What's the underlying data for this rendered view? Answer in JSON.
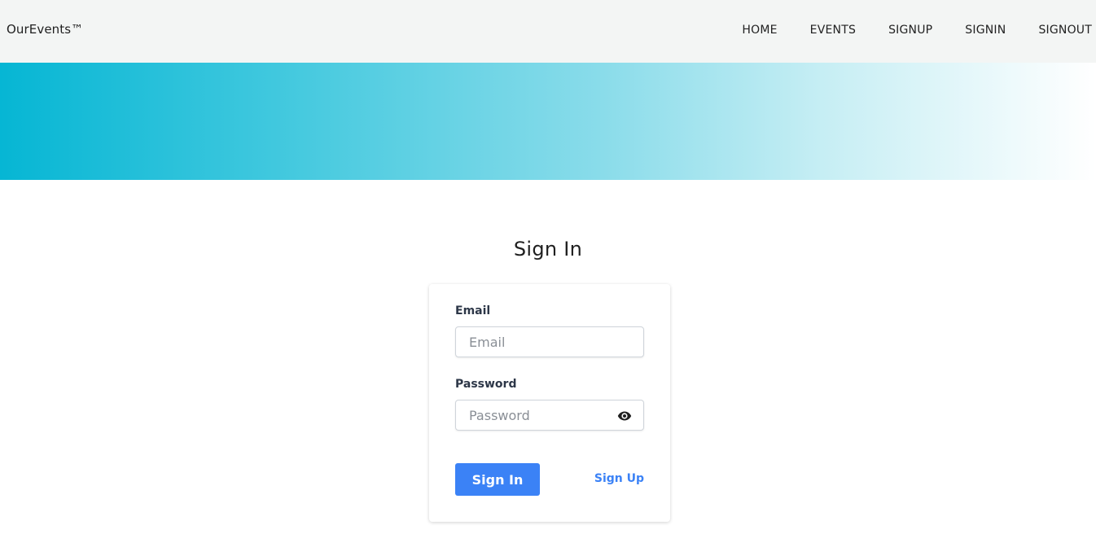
{
  "navbar": {
    "brand": "OurEvents™",
    "links": [
      {
        "label": "HOME"
      },
      {
        "label": "EVENTS"
      },
      {
        "label": "SIGNUP"
      },
      {
        "label": "SIGNIN"
      },
      {
        "label": "SIGNOUT"
      }
    ]
  },
  "page": {
    "title": "Sign In"
  },
  "form": {
    "email_label": "Email",
    "email_placeholder": "Email",
    "email_value": "",
    "password_label": "Password",
    "password_placeholder": "Password",
    "password_value": "",
    "password_toggle_icon": "eye-icon",
    "submit_label": "Sign In",
    "signup_link": "Sign Up"
  },
  "colors": {
    "navbar_bg": "#f3f5f4",
    "hero_start": "#06b6d4",
    "hero_end": "#ffffff",
    "primary": "#3b82f6"
  }
}
